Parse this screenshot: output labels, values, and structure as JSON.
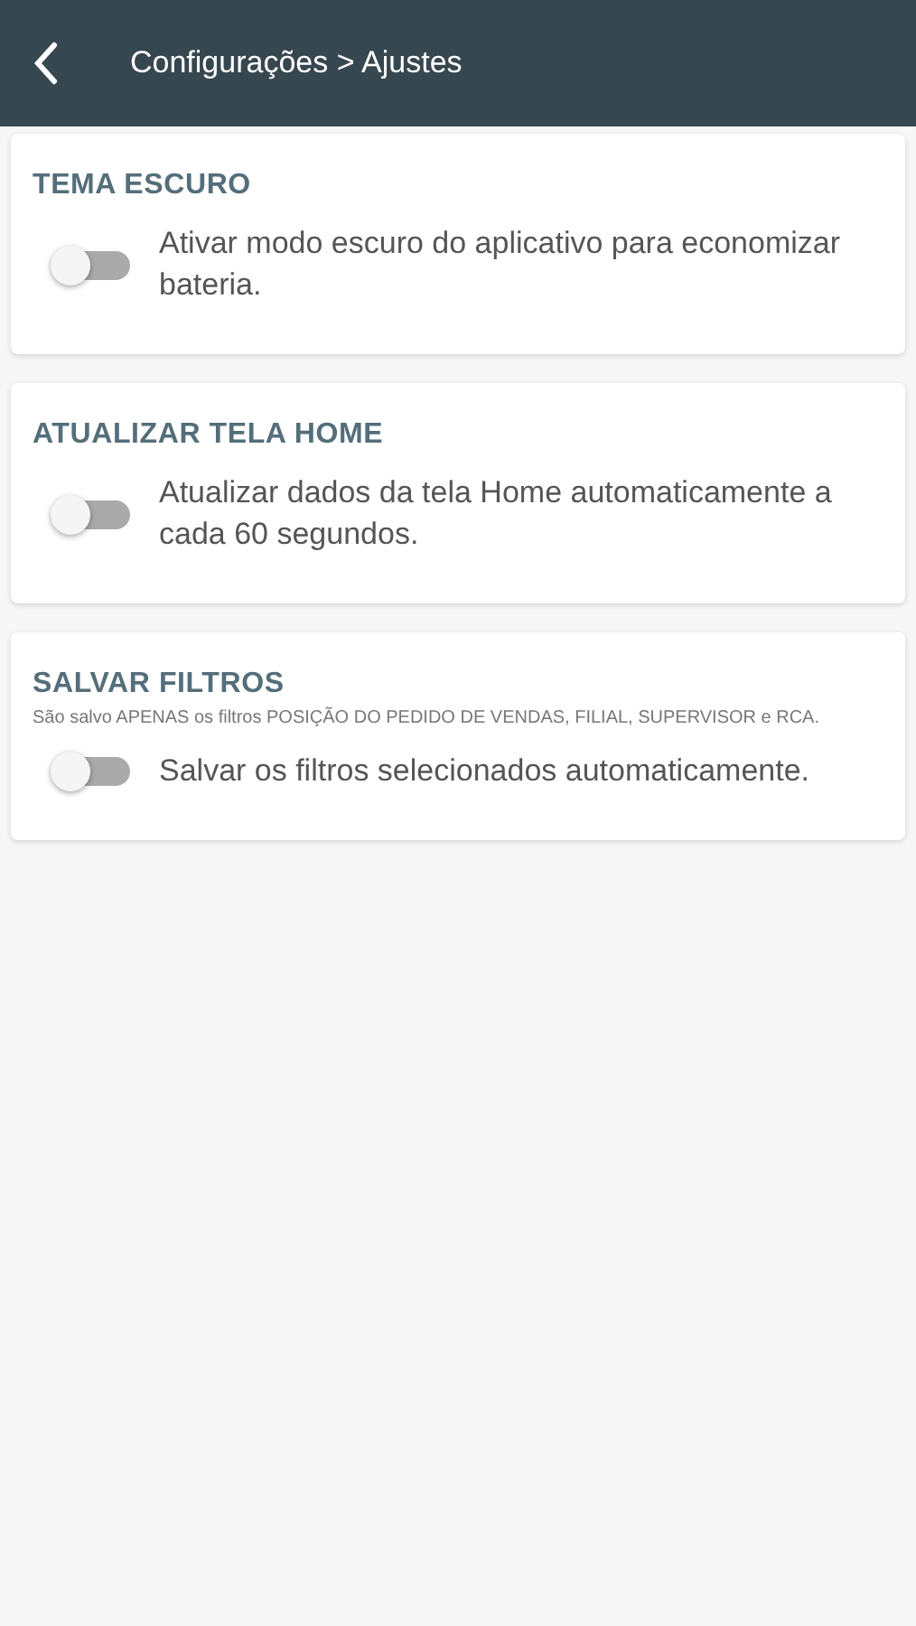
{
  "header": {
    "title": "Configurações > Ajustes"
  },
  "sections": [
    {
      "title": "TEMA ESCURO",
      "label": "Ativar modo escuro do aplicativo para economizar bateria.",
      "on": false
    },
    {
      "title": "ATUALIZAR TELA HOME",
      "label": "Atualizar dados da tela Home automaticamente a cada 60 segundos.",
      "on": false
    },
    {
      "title": "SALVAR FILTROS",
      "note": "São salvo APENAS os filtros POSIÇÃO DO PEDIDO DE VENDAS, FILIAL, SUPERVISOR e RCA.",
      "label": "Salvar os filtros selecionados automaticamente.",
      "on": false
    }
  ]
}
